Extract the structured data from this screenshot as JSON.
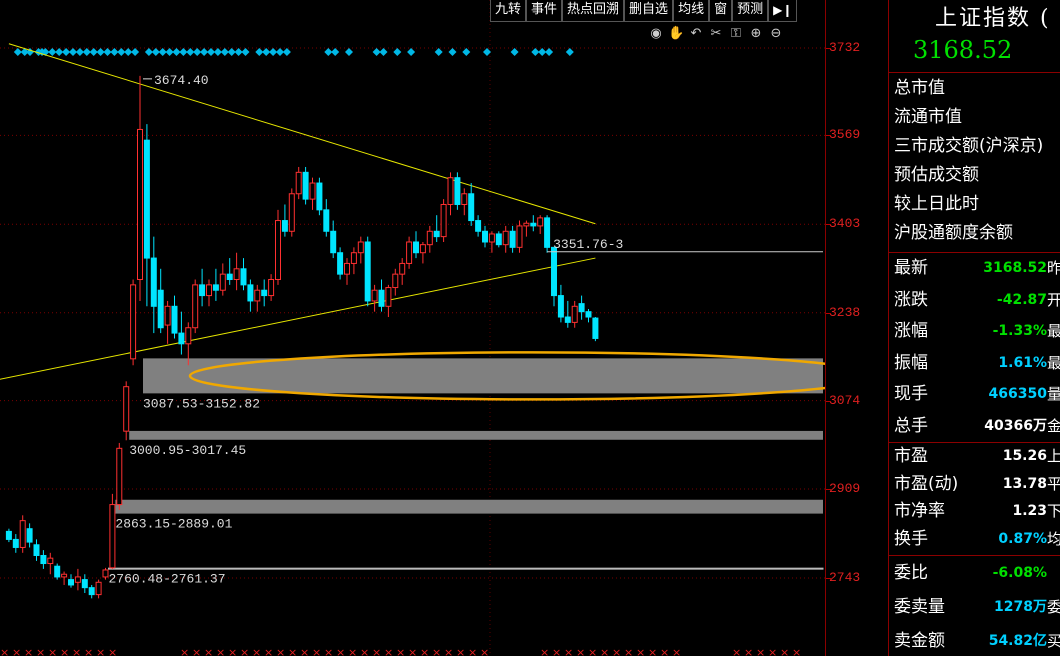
{
  "toolbar": {
    "buttons": [
      "九转",
      "事件",
      "热点回溯",
      "删自选",
      "均线",
      "窗",
      "预测"
    ]
  },
  "icons": [
    "eye-icon",
    "hand-icon",
    "undo-icon",
    "scissors-icon",
    "lock-icon",
    "zoom-in-icon",
    "zoom-out-icon"
  ],
  "price_axis": {
    "ticks": [
      "3732",
      "3569",
      "3403",
      "3238",
      "3074",
      "2909",
      "2743"
    ]
  },
  "annotations": {
    "high_label": "3674.40",
    "gap_label": "3351.76-3",
    "zone1": "3087.53-3152.82",
    "zone2": "3000.95-3017.45",
    "zone3": "2863.15-2889.01",
    "zone4": "2760.48-2761.37"
  },
  "panel": {
    "title": "上证指数 (",
    "price": "3168.52",
    "info": [
      "总市值",
      "流通市值",
      "三市成交额(沪深京)",
      "预估成交额",
      "较上日此时",
      "沪股通额度余额"
    ],
    "quotes": [
      {
        "label": "最新",
        "value": "3168.52",
        "tail": "昨",
        "color": "#00e000"
      },
      {
        "label": "涨跌",
        "value": "-42.87",
        "tail": "开",
        "color": "#00e000"
      },
      {
        "label": "涨幅",
        "value": "-1.33%",
        "tail": "最",
        "color": "#00e000"
      },
      {
        "label": "振幅",
        "value": "1.61%",
        "tail": "最",
        "color": "#00d0ff"
      },
      {
        "label": "现手",
        "value": "466350",
        "tail": "量",
        "color": "#00d0ff"
      },
      {
        "label": "总手",
        "value": "40366万",
        "tail": "金",
        "color": "#ffffff"
      }
    ],
    "ratios": [
      {
        "label": "市盈",
        "value": "15.26",
        "tail": "上",
        "color": "#ffffff"
      },
      {
        "label": "市盈(动)",
        "value": "13.78",
        "tail": "平",
        "color": "#ffffff"
      },
      {
        "label": "市净率",
        "value": "1.23",
        "tail": "下",
        "color": "#ffffff"
      },
      {
        "label": "换手",
        "value": "0.87%",
        "tail": "均",
        "color": "#00d0ff"
      }
    ],
    "orders": [
      {
        "label": "委比",
        "value": "-6.08%",
        "tail": "",
        "color": "#00e000"
      },
      {
        "label": "委卖量",
        "value": "1278万",
        "tail": "委",
        "color": "#00d0ff"
      },
      {
        "label": "卖金额",
        "value": "54.82亿",
        "tail": "买",
        "color": "#00d0ff"
      }
    ]
  },
  "chart_data": {
    "type": "candlestick",
    "ylim": [
      2700,
      3780
    ],
    "colors": {
      "up": "#ff3030",
      "down": "#00e5ff",
      "trendline": "#e6e600",
      "ellipse": "#f0a800",
      "zone": "#808080",
      "axis": "#e02020"
    },
    "candles": [
      [
        2830,
        2835,
        2810,
        2815
      ],
      [
        2815,
        2825,
        2790,
        2800
      ],
      [
        2800,
        2860,
        2790,
        2850
      ],
      [
        2835,
        2845,
        2800,
        2810
      ],
      [
        2805,
        2815,
        2775,
        2785
      ],
      [
        2785,
        2795,
        2760,
        2770
      ],
      [
        2770,
        2790,
        2750,
        2780
      ],
      [
        2765,
        2770,
        2740,
        2745
      ],
      [
        2745,
        2755,
        2730,
        2750
      ],
      [
        2740,
        2750,
        2725,
        2730
      ],
      [
        2735,
        2760,
        2720,
        2745
      ],
      [
        2740,
        2750,
        2715,
        2725
      ],
      [
        2725,
        2730,
        2705,
        2712
      ],
      [
        2712,
        2740,
        2705,
        2735
      ],
      [
        2745,
        2762,
        2740,
        2758
      ],
      [
        2762,
        2900,
        2760,
        2880
      ],
      [
        2880,
        2995,
        2870,
        2985
      ],
      [
        3017,
        3110,
        3000,
        3100
      ],
      [
        3152,
        3300,
        3140,
        3290
      ],
      [
        3300,
        3680,
        3260,
        3580
      ],
      [
        3560,
        3590,
        3250,
        3340
      ],
      [
        3340,
        3380,
        3200,
        3250
      ],
      [
        3280,
        3320,
        3200,
        3210
      ],
      [
        3215,
        3260,
        3180,
        3250
      ],
      [
        3250,
        3270,
        3190,
        3200
      ],
      [
        3200,
        3240,
        3160,
        3180
      ],
      [
        3180,
        3220,
        3140,
        3210
      ],
      [
        3210,
        3300,
        3200,
        3290
      ],
      [
        3290,
        3320,
        3250,
        3270
      ],
      [
        3270,
        3300,
        3250,
        3290
      ],
      [
        3290,
        3320,
        3260,
        3280
      ],
      [
        3280,
        3330,
        3270,
        3310
      ],
      [
        3310,
        3340,
        3290,
        3300
      ],
      [
        3300,
        3350,
        3280,
        3320
      ],
      [
        3320,
        3340,
        3280,
        3290
      ],
      [
        3290,
        3300,
        3240,
        3260
      ],
      [
        3260,
        3290,
        3240,
        3280
      ],
      [
        3280,
        3300,
        3250,
        3270
      ],
      [
        3270,
        3310,
        3260,
        3300
      ],
      [
        3300,
        3430,
        3290,
        3410
      ],
      [
        3410,
        3440,
        3380,
        3390
      ],
      [
        3390,
        3470,
        3380,
        3460
      ],
      [
        3460,
        3510,
        3450,
        3500
      ],
      [
        3500,
        3510,
        3440,
        3450
      ],
      [
        3450,
        3490,
        3430,
        3480
      ],
      [
        3480,
        3490,
        3420,
        3430
      ],
      [
        3430,
        3450,
        3380,
        3390
      ],
      [
        3390,
        3410,
        3340,
        3350
      ],
      [
        3350,
        3360,
        3300,
        3310
      ],
      [
        3310,
        3340,
        3290,
        3330
      ],
      [
        3330,
        3360,
        3310,
        3350
      ],
      [
        3350,
        3380,
        3330,
        3370
      ],
      [
        3370,
        3380,
        3250,
        3260
      ],
      [
        3260,
        3290,
        3240,
        3280
      ],
      [
        3280,
        3300,
        3240,
        3250
      ],
      [
        3250,
        3290,
        3230,
        3285
      ],
      [
        3285,
        3320,
        3270,
        3310
      ],
      [
        3310,
        3340,
        3290,
        3330
      ],
      [
        3330,
        3380,
        3320,
        3370
      ],
      [
        3370,
        3390,
        3340,
        3350
      ],
      [
        3350,
        3370,
        3330,
        3365
      ],
      [
        3365,
        3400,
        3350,
        3390
      ],
      [
        3390,
        3420,
        3370,
        3380
      ],
      [
        3380,
        3450,
        3370,
        3440
      ],
      [
        3440,
        3500,
        3420,
        3490
      ],
      [
        3490,
        3500,
        3430,
        3440
      ],
      [
        3440,
        3470,
        3420,
        3460
      ],
      [
        3460,
        3480,
        3400,
        3410
      ],
      [
        3410,
        3420,
        3380,
        3390
      ],
      [
        3390,
        3400,
        3360,
        3370
      ],
      [
        3370,
        3390,
        3350,
        3385
      ],
      [
        3385,
        3390,
        3360,
        3365
      ],
      [
        3365,
        3400,
        3350,
        3390
      ],
      [
        3390,
        3400,
        3350,
        3360
      ],
      [
        3360,
        3410,
        3350,
        3400
      ],
      [
        3400,
        3410,
        3380,
        3405
      ],
      [
        3405,
        3420,
        3390,
        3400
      ],
      [
        3400,
        3420,
        3385,
        3415
      ],
      [
        3415,
        3420,
        3350,
        3360
      ],
      [
        3360,
        3360,
        3250,
        3270
      ],
      [
        3270,
        3290,
        3220,
        3230
      ],
      [
        3230,
        3260,
        3210,
        3220
      ],
      [
        3220,
        3260,
        3210,
        3250
      ],
      [
        3255,
        3270,
        3225,
        3240
      ],
      [
        3240,
        3245,
        3220,
        3230
      ],
      [
        3228,
        3230,
        3185,
        3190
      ]
    ],
    "trendlines": [
      [
        0,
        3740,
        85,
        3404
      ],
      [
        -18,
        3070,
        85,
        3340
      ]
    ],
    "zones": [
      [
        3087.53,
        3152.82,
        19,
        88
      ],
      [
        3000.95,
        3017.45,
        17,
        88
      ],
      [
        2863.15,
        2889.01,
        15,
        88
      ],
      [
        2760.48,
        2761.37,
        14,
        88
      ]
    ],
    "gap_line": {
      "price": 3351.76,
      "from": 78,
      "to": 88
    },
    "high_point": {
      "index": 19,
      "price": 3674.4
    },
    "top_markers": [
      -15,
      -13,
      1,
      2,
      4,
      5,
      6,
      7,
      8,
      9,
      10,
      11,
      12,
      13,
      14,
      15,
      16,
      17,
      18,
      20,
      21,
      22,
      23,
      24,
      25,
      26,
      27,
      28,
      29,
      30,
      31,
      32,
      33,
      34,
      36,
      37,
      38,
      39,
      40,
      46,
      47,
      49,
      53,
      54,
      56,
      58,
      62,
      64,
      66,
      69,
      73,
      76,
      77,
      78,
      81
    ]
  }
}
